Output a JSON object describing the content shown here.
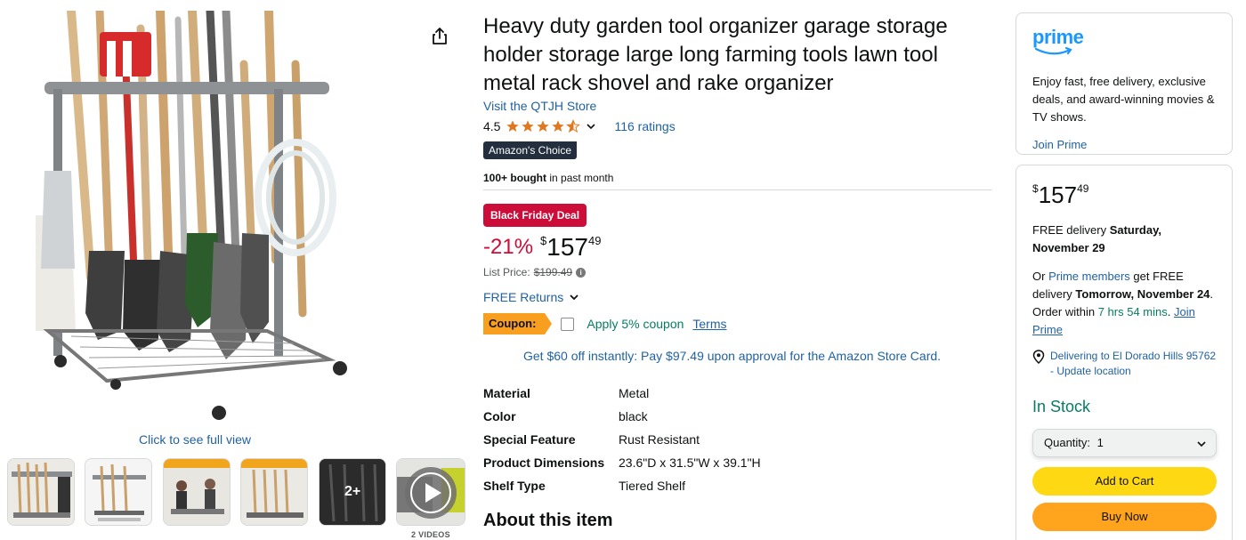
{
  "product": {
    "title": "Heavy duty garden tool organizer garage storage holder storage large long farming tools lawn tool metal rack shovel and rake organizer",
    "store_link": "Visit the QTJH Store",
    "rating_value": "4.5",
    "ratings_count": "116 ratings",
    "choice_badge": "Amazon's Choice",
    "bought_bold": "100+ bought",
    "bought_rest": " in past month",
    "deal_badge": "Black Friday Deal",
    "discount": "-21%",
    "currency": "$",
    "price_whole": "157",
    "price_fraction": "49",
    "list_price_label": "List Price:",
    "list_price": "$199.49",
    "free_returns": "FREE Returns",
    "coupon_label": "Coupon:",
    "coupon_apply": "Apply 5% coupon",
    "coupon_terms": "Terms",
    "card_offer": "Get $60 off instantly: Pay $97.49 upon approval for the Amazon Store Card.",
    "specs": [
      {
        "key": "Material",
        "value": "Metal"
      },
      {
        "key": "Color",
        "value": "black"
      },
      {
        "key": "Special Feature",
        "value": "Rust Resistant"
      },
      {
        "key": "Product Dimensions",
        "value": "23.6\"D x 31.5\"W x 39.1\"H"
      },
      {
        "key": "Shelf Type",
        "value": "Tiered Shelf"
      }
    ],
    "about_heading": "About this item"
  },
  "gallery": {
    "full_view": "Click to see full view",
    "more_label": "2+",
    "videos_label": "2 VIDEOS"
  },
  "prime": {
    "logo_text": "prime",
    "text": "Enjoy fast, free delivery, exclusive deals, and award-winning movies & TV shows.",
    "join": "Join Prime"
  },
  "buybox": {
    "currency": "$",
    "price_whole": "157",
    "price_fraction": "49",
    "delivery_prefix": "FREE delivery ",
    "delivery_date": "Saturday, November 29",
    "fastest_1": "Or ",
    "fastest_prime": "Prime members",
    "fastest_2": " get FREE delivery ",
    "fastest_date": "Tomorrow, November 24",
    "fastest_3": ". Order within ",
    "fastest_time": "7 hrs 54 mins",
    "fastest_4": ". ",
    "fastest_join": "Join Prime",
    "location": "Delivering to El Dorado Hills 95762 - Update location",
    "stock": "In Stock",
    "quantity_label": "Quantity:",
    "quantity_value": "1",
    "add_to_cart": "Add to Cart",
    "buy_now": "Buy Now"
  },
  "colors": {
    "link": "#2162a1",
    "deal_red": "#cc0c39",
    "star": "#de7921",
    "green": "#067d62",
    "add_to_cart": "#ffd814",
    "buy_now": "#ffa41c",
    "coupon": "#f99f20"
  },
  "icons": [
    "share-icon",
    "star-icon",
    "chevron-down-icon",
    "info-icon",
    "location-pin-icon",
    "play-icon"
  ]
}
